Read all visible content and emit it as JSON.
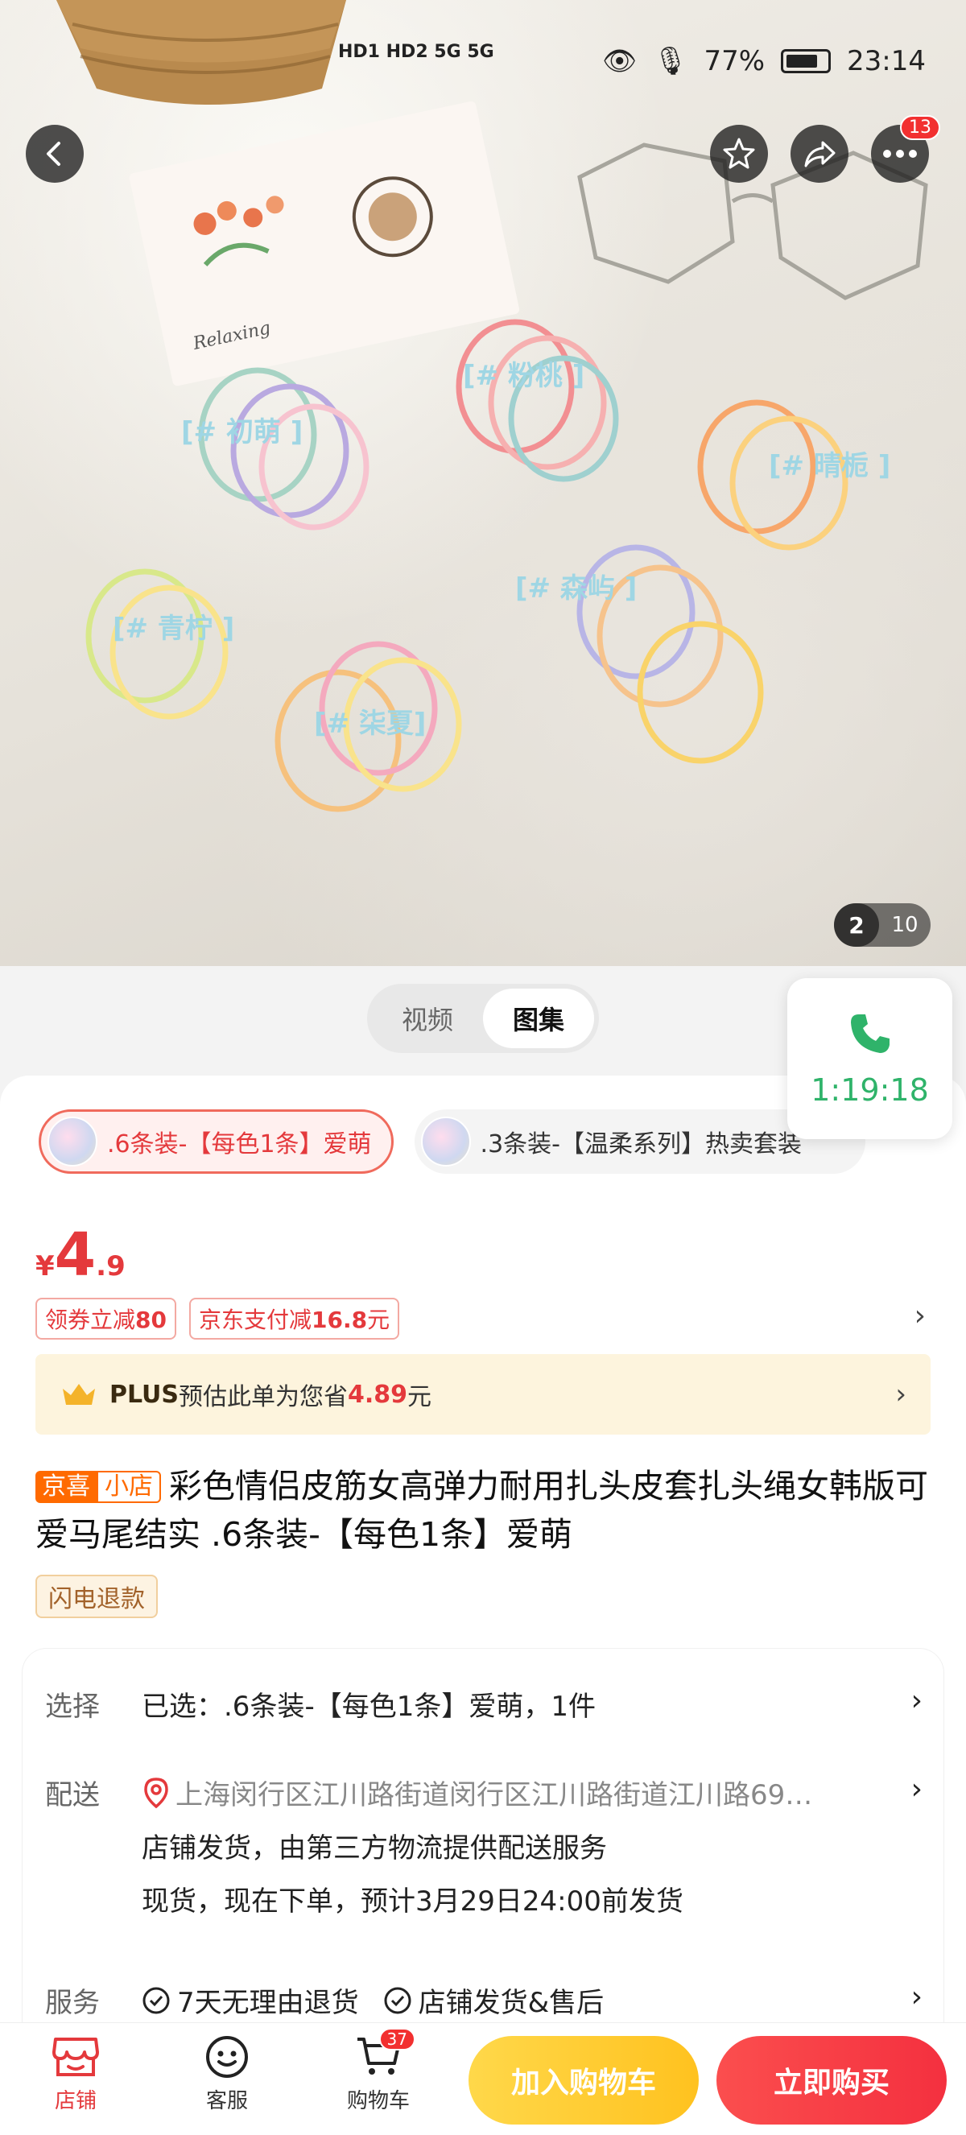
{
  "status_bar": {
    "hd_labels": "HD1 HD2",
    "signal_1": "5G",
    "signal_2": "5G",
    "battery_pct": "77%",
    "time": "23:14"
  },
  "top_actions": {
    "more_badge": "13"
  },
  "gallery": {
    "image_labels": [
      "[# 初萌 ]",
      "[# 粉桃 ]",
      "[# 晴栀 ]",
      "[# 森屿 ]",
      "[# 青柠 ]",
      "[# 柒夏]"
    ],
    "card_text": "Relaxing",
    "current_index": "2",
    "total": "10"
  },
  "media_tabs": [
    "视频",
    "图集"
  ],
  "call_float": {
    "duration": "1:19:18"
  },
  "variants": [
    {
      "label": ".6条装-【每色1条】爱萌",
      "selected": true
    },
    {
      "label": ".3条装-【温柔系列】热卖套装",
      "selected": false
    }
  ],
  "price": {
    "currency": "¥",
    "integer": "4",
    "decimal": ".9"
  },
  "coupons": [
    {
      "prefix": "领券立减",
      "amount": "80",
      "suffix": ""
    },
    {
      "prefix": "京东支付减",
      "amount": "16.8",
      "suffix": "元"
    }
  ],
  "plus_bar": {
    "brand": "PLUS",
    "text": "预估此单为您省",
    "amount": "4.89",
    "suffix": "元"
  },
  "title": {
    "tag1": "京喜",
    "tag2": "小店",
    "text": "彩色情侣皮筋女高弹力耐用扎头皮套扎头绳女韩版可爱马尾结实 .6条装-【每色1条】爱萌"
  },
  "refund_tag": "闪电退款",
  "info": {
    "select_label": "选择",
    "select_value": "已选：.6条装-【每色1条】爱萌，1件",
    "delivery_label": "配送",
    "delivery_address": "上海闵行区江川路街道闵行区江川路街道江川路69…",
    "delivery_line2": "店铺发货，由第三方物流提供配送服务",
    "delivery_line3": "现货，现在下单，预计3月29日24:00前发货",
    "service_label": "服务",
    "services": [
      "7天无理由退货",
      "店铺发货&售后"
    ]
  },
  "bottom_bar": {
    "shop": "店铺",
    "service": "客服",
    "cart": "购物车",
    "cart_badge": "37",
    "add_to_cart": "加入购物车",
    "buy_now": "立即购买"
  },
  "colors": {
    "jd_red": "#e4393c",
    "call_green": "#2fb36a",
    "jx_orange": "#ff6a00",
    "cart_yellow": "#ffc21f"
  }
}
